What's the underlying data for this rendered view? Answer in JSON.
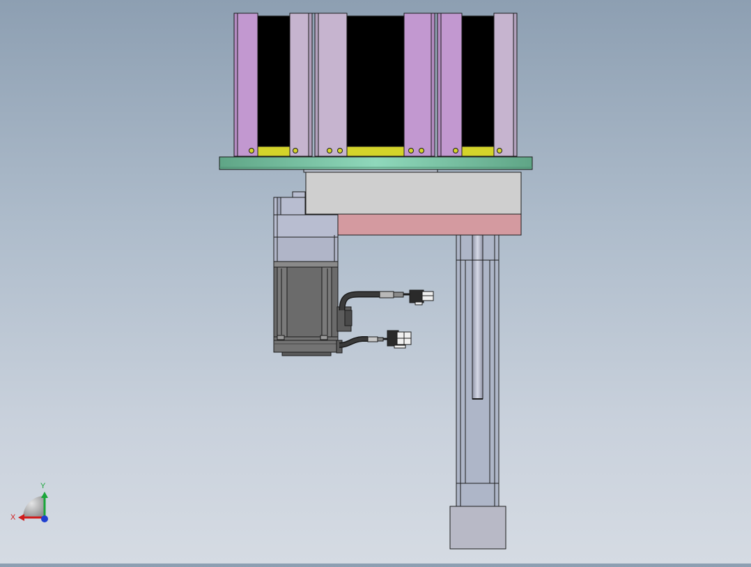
{
  "viewport": {
    "background_top": "#8d9fb2",
    "background_bottom": "#d5dbe3"
  },
  "palette": {
    "outline": "#1a1a1a",
    "dark_panel": "#000000",
    "purple_light": "#c6b4cf",
    "purple_mid": "#c298d0",
    "yellow": "#d4d42a",
    "teal_plate": "#6fbf9f",
    "gray_block": "#cfcfcf",
    "pink_block": "#d49aa0",
    "motor_gray": "#6b6b6b",
    "actuator_blue": "#aeb6c8",
    "foot_gray": "#b8b9c6"
  },
  "triad": {
    "x_label": "X",
    "y_label": "Y",
    "x_color": "#d01c1c",
    "y_color": "#1aa63a",
    "z_color": "#1f3fd0"
  },
  "components": [
    "top-bracket-assembly",
    "mounting-plate",
    "linear-module-block",
    "servo-motor",
    "motor-cable-connector",
    "encoder-cable-connector",
    "vertical-actuator",
    "actuator-base"
  ]
}
